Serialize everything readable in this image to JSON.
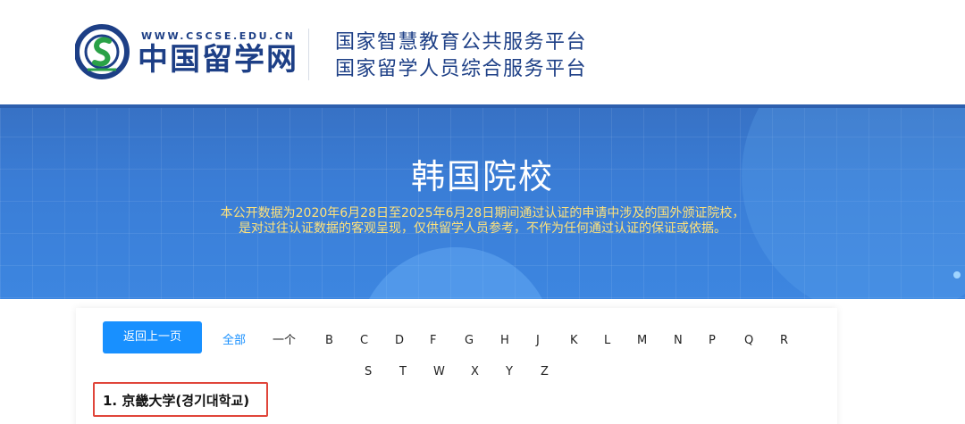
{
  "header": {
    "logo": {
      "url_text": "WWW.CSCSE.EDU.CN",
      "name": "中国留学网"
    },
    "platform_line1": "国家智慧教育公共服务平台",
    "platform_line2": "国家留学人员综合服务平台"
  },
  "banner": {
    "title": "韩国院校",
    "desc_line1": "本公开数据为2020年6月28日至2025年6月28日期间通过认证的申请中涉及的国外颁证院校，",
    "desc_line2": "是对过往认证数据的客观呈现，仅供留学人员参考，不作为任何通过认证的保证或依据。"
  },
  "nav": {
    "back_label": "返回上一页",
    "all_label": "全部",
    "letters_row1": [
      "一个",
      "B",
      "C",
      "D",
      "F",
      "G",
      "H",
      "J",
      "K",
      "L",
      "M",
      "N",
      "P",
      "Q",
      "R"
    ],
    "letters_row2": [
      "S",
      "T",
      "W",
      "X",
      "Y",
      "Z"
    ]
  },
  "list": {
    "first_item": "1. 京畿大学(경기대학교)"
  },
  "colors": {
    "brand_blue": "#1d3f86",
    "button_blue": "#1890ff",
    "highlight_red": "#e0453a",
    "desc_yellow": "#ffe27a"
  }
}
